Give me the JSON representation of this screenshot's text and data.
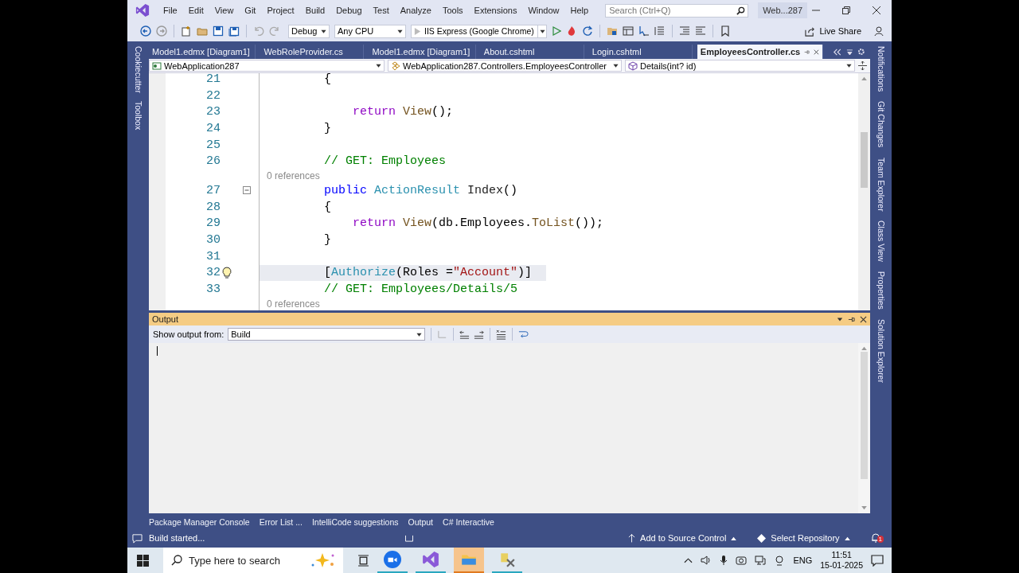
{
  "window": {
    "title": "Web...287"
  },
  "menu": [
    "File",
    "Edit",
    "View",
    "Git",
    "Project",
    "Build",
    "Debug",
    "Test",
    "Analyze",
    "Tools",
    "Extensions",
    "Window",
    "Help"
  ],
  "search": {
    "placeholder": "Search (Ctrl+Q)"
  },
  "toolbar": {
    "configuration": "Debug",
    "platform": "Any CPU",
    "start": "IIS Express (Google Chrome)",
    "live_share": "Live Share"
  },
  "left_tabs": [
    "Cookiecutter",
    "Toolbox"
  ],
  "right_tabs": [
    "Notifications",
    "Git Changes",
    "Team Explorer",
    "Class View",
    "Properties",
    "Solution Explorer"
  ],
  "doc_tabs": [
    {
      "label": "Model1.edmx [Diagram1]",
      "selected": false
    },
    {
      "label": "WebRoleProvider.cs",
      "selected": false
    },
    {
      "label": "Model1.edmx [Diagram1]",
      "selected": false
    },
    {
      "label": "About.cshtml",
      "selected": false
    },
    {
      "label": "Login.cshtml",
      "selected": false
    },
    {
      "label": "EmployeesController.cs",
      "selected": true
    }
  ],
  "nav_bar": {
    "project": "WebApplication287",
    "type": "WebApplication287.Controllers.EmployeesController",
    "member": "Details(int? id)"
  },
  "editor": {
    "lines": [
      {
        "kind": "code",
        "number": "21",
        "highlighted": false,
        "lightbulb": false,
        "foldable": false,
        "tokens": [
          {
            "kind": "plain",
            "text": "        {"
          }
        ]
      },
      {
        "kind": "code",
        "number": "22",
        "highlighted": false,
        "lightbulb": false,
        "foldable": false
      },
      {
        "kind": "code",
        "number": "23",
        "highlighted": false,
        "lightbulb": false,
        "foldable": false,
        "tokens": [
          {
            "kind": "control",
            "text": "            return"
          },
          {
            "kind": "method",
            "text": " View"
          },
          {
            "kind": "plain",
            "text": "();"
          }
        ]
      },
      {
        "kind": "code",
        "number": "24",
        "highlighted": false,
        "lightbulb": false,
        "foldable": false,
        "tokens": [
          {
            "kind": "plain",
            "text": "        }"
          }
        ]
      },
      {
        "kind": "code",
        "number": "25",
        "highlighted": false,
        "lightbulb": false,
        "foldable": false
      },
      {
        "kind": "code",
        "number": "26",
        "highlighted": false,
        "lightbulb": false,
        "foldable": false,
        "tokens": [
          {
            "kind": "comment",
            "text": "        // GET: Employees"
          }
        ]
      },
      {
        "kind": "lens",
        "text": "0 references"
      },
      {
        "kind": "code",
        "number": "27",
        "highlighted": false,
        "lightbulb": false,
        "foldable": true,
        "tokens": [
          {
            "kind": "keyword",
            "text": "        public"
          },
          {
            "kind": "type",
            "text": " ActionResult"
          },
          {
            "kind": "name",
            "text": " Index"
          },
          {
            "kind": "plain",
            "text": "()"
          }
        ]
      },
      {
        "kind": "code",
        "number": "28",
        "highlighted": false,
        "lightbulb": false,
        "foldable": false,
        "tokens": [
          {
            "kind": "plain",
            "text": "        {"
          }
        ]
      },
      {
        "kind": "code",
        "number": "29",
        "highlighted": false,
        "lightbulb": false,
        "foldable": false,
        "tokens": [
          {
            "kind": "control",
            "text": "            return"
          },
          {
            "kind": "method",
            "text": " View"
          },
          {
            "kind": "plain",
            "text": "(db.Employees."
          },
          {
            "kind": "method",
            "text": "ToList"
          },
          {
            "kind": "plain",
            "text": "());"
          }
        ]
      },
      {
        "kind": "code",
        "number": "30",
        "highlighted": false,
        "lightbulb": false,
        "foldable": false,
        "tokens": [
          {
            "kind": "plain",
            "text": "        }"
          }
        ]
      },
      {
        "kind": "code",
        "number": "31",
        "highlighted": false,
        "lightbulb": false,
        "foldable": false
      },
      {
        "kind": "code",
        "number": "32",
        "highlighted": true,
        "lightbulb": true,
        "foldable": false,
        "tokens": [
          {
            "kind": "plain",
            "text": "        ["
          },
          {
            "kind": "type",
            "text": "Authorize"
          },
          {
            "kind": "plain",
            "text": "(Roles ="
          },
          {
            "kind": "string",
            "text": "\"Account\""
          },
          {
            "kind": "plain",
            "text": ")]"
          }
        ]
      },
      {
        "kind": "code",
        "number": "33",
        "highlighted": false,
        "lightbulb": false,
        "foldable": false,
        "tokens": [
          {
            "kind": "comment",
            "text": "        // GET: Employees/Details/5"
          }
        ]
      },
      {
        "kind": "lens",
        "text": "0 references"
      }
    ]
  },
  "output": {
    "title": "Output",
    "source_label": "Show output from:",
    "source": "Build"
  },
  "tool_tabs": [
    "Package Manager Console",
    "Error List ...",
    "IntelliCode suggestions",
    "Output",
    "C# Interactive"
  ],
  "status_bar": {
    "message": "Build started...",
    "source_control": "Add to Source Control",
    "repository": "Select Repository",
    "notifications": "1"
  },
  "taskbar": {
    "search_placeholder": "Type here to search",
    "language": "ENG",
    "time": "11:51",
    "date": "15-01-2025"
  }
}
